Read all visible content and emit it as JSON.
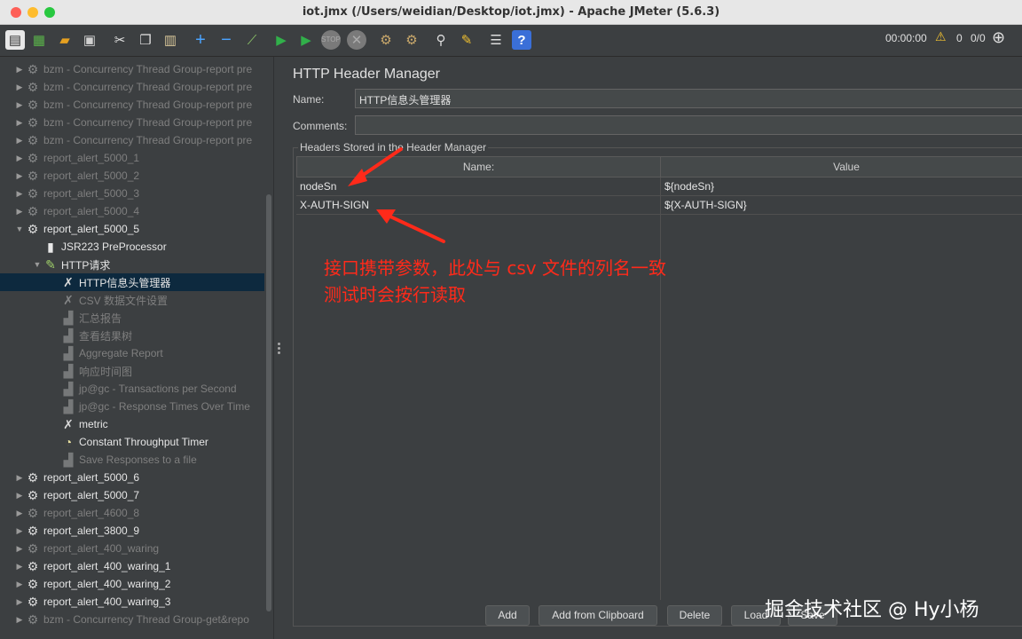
{
  "window": {
    "title": "iot.jmx (/Users/weidian/Desktop/iot.jmx) - Apache JMeter (5.6.3)"
  },
  "toolbar": {
    "timer": "00:00:00",
    "warning_count": "0",
    "threads": "0/0",
    "icons": [
      "new-icon",
      "templates-icon",
      "open-icon",
      "save-icon",
      "cut-icon",
      "copy-icon",
      "paste-icon",
      "expand-icon",
      "collapse-icon",
      "toggle-icon",
      "start-icon",
      "start-no-timers-icon",
      "stop-icon",
      "shutdown-icon",
      "clear-icon",
      "clear-all-icon",
      "search-icon",
      "reset-search-icon",
      "function-helper-icon",
      "help-icon"
    ]
  },
  "tree": {
    "items": [
      {
        "label": "bzm - Concurrency Thread Group-report pre",
        "icon": "gear-icon",
        "disabled": true,
        "level": 0,
        "expander": "right"
      },
      {
        "label": "bzm - Concurrency Thread Group-report pre",
        "icon": "gear-icon",
        "disabled": true,
        "level": 0,
        "expander": "right"
      },
      {
        "label": "bzm - Concurrency Thread Group-report pre",
        "icon": "gear-icon",
        "disabled": true,
        "level": 0,
        "expander": "right"
      },
      {
        "label": "bzm - Concurrency Thread Group-report pre",
        "icon": "gear-icon",
        "disabled": true,
        "level": 0,
        "expander": "right"
      },
      {
        "label": "bzm - Concurrency Thread Group-report pre",
        "icon": "gear-icon",
        "disabled": true,
        "level": 0,
        "expander": "right"
      },
      {
        "label": "report_alert_5000_1",
        "icon": "gear-icon",
        "disabled": true,
        "level": 0,
        "expander": "right"
      },
      {
        "label": "report_alert_5000_2",
        "icon": "gear-icon",
        "disabled": true,
        "level": 0,
        "expander": "right"
      },
      {
        "label": "report_alert_5000_3",
        "icon": "gear-icon",
        "disabled": true,
        "level": 0,
        "expander": "right"
      },
      {
        "label": "report_alert_5000_4",
        "icon": "gear-icon",
        "disabled": true,
        "level": 0,
        "expander": "right"
      },
      {
        "label": "report_alert_5000_5",
        "icon": "gear-icon",
        "disabled": false,
        "level": 0,
        "expander": "down"
      },
      {
        "label": "JSR223 PreProcessor",
        "icon": "script-icon",
        "disabled": false,
        "level": 1,
        "expander": ""
      },
      {
        "label": "HTTP请求",
        "icon": "sampler-icon",
        "disabled": false,
        "level": 1,
        "expander": "down"
      },
      {
        "label": "HTTP信息头管理器",
        "icon": "wrench-icon",
        "disabled": false,
        "level": 2,
        "expander": "",
        "selected": true
      },
      {
        "label": "CSV 数据文件设置",
        "icon": "wrench-icon",
        "disabled": true,
        "level": 2,
        "expander": ""
      },
      {
        "label": "汇总报告",
        "icon": "chart-icon",
        "disabled": true,
        "level": 2,
        "expander": ""
      },
      {
        "label": "查看结果树",
        "icon": "chart-icon",
        "disabled": true,
        "level": 2,
        "expander": ""
      },
      {
        "label": "Aggregate Report",
        "icon": "chart-icon",
        "disabled": true,
        "level": 2,
        "expander": ""
      },
      {
        "label": "响应时间图",
        "icon": "chart-icon",
        "disabled": true,
        "level": 2,
        "expander": ""
      },
      {
        "label": "jp@gc - Transactions per Second",
        "icon": "chart-icon",
        "disabled": true,
        "level": 2,
        "expander": ""
      },
      {
        "label": "jp@gc - Response Times Over Time",
        "icon": "chart-icon",
        "disabled": true,
        "level": 2,
        "expander": ""
      },
      {
        "label": "metric",
        "icon": "wrench-icon",
        "disabled": false,
        "level": 2,
        "expander": ""
      },
      {
        "label": "Constant Throughput Timer",
        "icon": "timer-icon",
        "disabled": false,
        "level": 2,
        "expander": ""
      },
      {
        "label": "Save Responses to a file",
        "icon": "chart-icon",
        "disabled": true,
        "level": 2,
        "expander": ""
      },
      {
        "label": "report_alert_5000_6",
        "icon": "gear-icon",
        "disabled": false,
        "level": 0,
        "expander": "right"
      },
      {
        "label": "report_alert_5000_7",
        "icon": "gear-icon",
        "disabled": false,
        "level": 0,
        "expander": "right"
      },
      {
        "label": "report_alert_4600_8",
        "icon": "gear-icon",
        "disabled": true,
        "level": 0,
        "expander": "right"
      },
      {
        "label": "report_alert_3800_9",
        "icon": "gear-icon",
        "disabled": false,
        "level": 0,
        "expander": "right"
      },
      {
        "label": "report_alert_400_waring",
        "icon": "gear-icon",
        "disabled": true,
        "level": 0,
        "expander": "right"
      },
      {
        "label": "report_alert_400_waring_1",
        "icon": "gear-icon",
        "disabled": false,
        "level": 0,
        "expander": "right"
      },
      {
        "label": "report_alert_400_waring_2",
        "icon": "gear-icon",
        "disabled": false,
        "level": 0,
        "expander": "right"
      },
      {
        "label": "report_alert_400_waring_3",
        "icon": "gear-icon",
        "disabled": false,
        "level": 0,
        "expander": "right"
      },
      {
        "label": "bzm - Concurrency Thread Group-get&repo",
        "icon": "gear-icon",
        "disabled": true,
        "level": 0,
        "expander": "right"
      }
    ]
  },
  "panel": {
    "title": "HTTP Header Manager",
    "name_label": "Name:",
    "name_value": "HTTP信息头管理器",
    "comments_label": "Comments:",
    "comments_value": "",
    "group_label": "Headers Stored in the Header Manager",
    "table": {
      "headers": [
        "Name:",
        "Value"
      ],
      "rows": [
        [
          "nodeSn",
          "${nodeSn}"
        ],
        [
          "X-AUTH-SIGN",
          "${X-AUTH-SIGN}"
        ]
      ]
    },
    "buttons": {
      "add": "Add",
      "add_clipboard": "Add from Clipboard",
      "delete": "Delete",
      "load": "Load",
      "save": "Save"
    }
  },
  "annotation": {
    "line1": "接口携带参数，此处与 csv 文件的列名一致",
    "line2": "测试时会按行读取",
    "color": "#ff2a1a"
  },
  "watermark": "掘金技术社区 @ Hy小杨"
}
